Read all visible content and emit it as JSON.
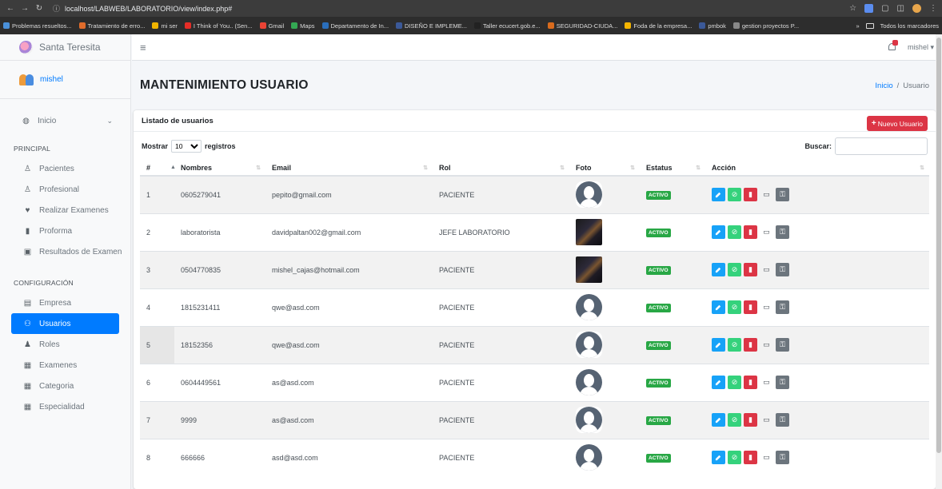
{
  "browser": {
    "url": "localhost/LABWEB/LABORATORIO/view/index.php#",
    "bookmarks": [
      {
        "label": "Problemas resueltos...",
        "color": "#4a90d9"
      },
      {
        "label": "Tratamiento de erro...",
        "color": "#e06c2b"
      },
      {
        "label": "mi ser",
        "color": "#f0b400"
      },
      {
        "label": "I Think of You.. (Sen...",
        "color": "#e52d27"
      },
      {
        "label": "Gmail",
        "color": "#ea4335"
      },
      {
        "label": "Maps",
        "color": "#34a853"
      },
      {
        "label": "Departamento de In...",
        "color": "#2a6ebb"
      },
      {
        "label": "DISEÑO E IMPLEME...",
        "color": "#3b5998"
      },
      {
        "label": "Taller ecucert.gob.e...",
        "color": "#222222"
      },
      {
        "label": "SEGURIDAD-CIUDA...",
        "color": "#d96b1d"
      },
      {
        "label": "Foda de la empresa...",
        "color": "#f4b400"
      },
      {
        "label": "pmbok",
        "color": "#3b5998"
      },
      {
        "label": "gestion proyectos P...",
        "color": "#888888"
      }
    ],
    "all_bookmarks": "Todos los marcadores"
  },
  "sidebar": {
    "brand": "Santa Teresita",
    "user": "mishel",
    "inicio": "Inicio",
    "section_principal": "PRINCIPAL",
    "principal_items": [
      {
        "label": "Pacientes",
        "icon": "user-injured-icon"
      },
      {
        "label": "Profesional",
        "icon": "user-md-icon"
      },
      {
        "label": "Realizar Examenes",
        "icon": "heartbeat-icon"
      },
      {
        "label": "Proforma",
        "icon": "file-icon"
      },
      {
        "label": "Resultados de Examen",
        "icon": "results-icon"
      }
    ],
    "section_config": "CONFIGURACIÓN",
    "config_items": [
      {
        "label": "Empresa",
        "icon": "id-card-icon"
      },
      {
        "label": "Usuarios",
        "icon": "users-icon",
        "active": true
      },
      {
        "label": "Roles",
        "icon": "user-tie-icon"
      },
      {
        "label": "Examenes",
        "icon": "clipboard-icon"
      },
      {
        "label": "Categoria",
        "icon": "clipboard-list-icon"
      },
      {
        "label": "Especialidad",
        "icon": "clipboard-list-icon"
      }
    ]
  },
  "topbar": {
    "user": "mishel"
  },
  "header": {
    "title": "MANTENIMIENTO USUARIO",
    "breadcrumb_home": "Inicio",
    "breadcrumb_sep": "/",
    "breadcrumb_current": "Usuario"
  },
  "card": {
    "title": "Listado de usuarios",
    "new_button": "Nuevo Usuario",
    "show_label": "Mostrar",
    "show_value": "10",
    "records_label": "registros",
    "search_label": "Buscar:"
  },
  "table": {
    "columns": [
      "#",
      "Nombres",
      "Email",
      "Rol",
      "Foto",
      "Estatus",
      "Acción"
    ],
    "rows": [
      {
        "n": "1",
        "nombre": "0605279041",
        "email": "pepito@gmail.com",
        "rol": "PACIENTE",
        "foto": "default",
        "estatus": "ACTIVO"
      },
      {
        "n": "2",
        "nombre": "laboratorista",
        "email": "davidpaltan002@gmail.com",
        "rol": "JEFE LABORATORIO",
        "foto": "custom",
        "estatus": "ACTIVO"
      },
      {
        "n": "3",
        "nombre": "0504770835",
        "email": "mishel_cajas@hotmail.com",
        "rol": "PACIENTE",
        "foto": "custom",
        "estatus": "ACTIVO"
      },
      {
        "n": "4",
        "nombre": "1815231411",
        "email": "qwe@asd.com",
        "rol": "PACIENTE",
        "foto": "default",
        "estatus": "ACTIVO"
      },
      {
        "n": "5",
        "nombre": "18152356",
        "email": "qwe@asd.com",
        "rol": "PACIENTE",
        "foto": "default",
        "estatus": "ACTIVO"
      },
      {
        "n": "6",
        "nombre": "0604449561",
        "email": "as@asd.com",
        "rol": "PACIENTE",
        "foto": "default",
        "estatus": "ACTIVO"
      },
      {
        "n": "7",
        "nombre": "9999",
        "email": "as@asd.com",
        "rol": "PACIENTE",
        "foto": "default",
        "estatus": "ACTIVO"
      },
      {
        "n": "8",
        "nombre": "666666",
        "email": "asd@asd.com",
        "rol": "PACIENTE",
        "foto": "default",
        "estatus": "ACTIVO"
      }
    ]
  }
}
